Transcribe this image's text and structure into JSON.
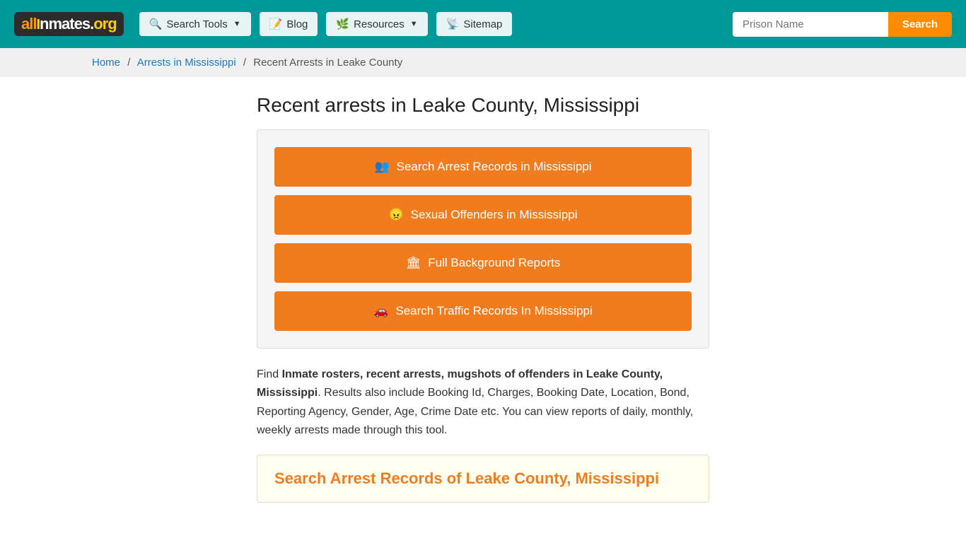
{
  "header": {
    "logo": "allinmates.org",
    "nav": [
      {
        "id": "search-tools",
        "label": "Search Tools",
        "has_arrow": true
      },
      {
        "id": "blog",
        "label": "Blog",
        "has_arrow": false
      },
      {
        "id": "resources",
        "label": "Resources",
        "has_arrow": true
      },
      {
        "id": "sitemap",
        "label": "Sitemap",
        "has_arrow": false
      }
    ],
    "search_placeholder": "Prison Name",
    "search_btn_label": "Search"
  },
  "breadcrumb": {
    "home": "Home",
    "sep1": "/",
    "arrests": "Arrests in Mississippi",
    "sep2": "/",
    "current": "Recent Arrests in Leake County"
  },
  "page": {
    "title": "Recent arrests in Leake County, Mississippi",
    "buttons": [
      {
        "id": "arrest-records",
        "icon": "👥",
        "label": "Search Arrest Records in Mississippi"
      },
      {
        "id": "sex-offenders",
        "icon": "😠",
        "label": "Sexual Offenders in Mississippi"
      },
      {
        "id": "background-reports",
        "icon": "🏛",
        "label": "Full Background Reports"
      },
      {
        "id": "traffic-records",
        "icon": "🚗",
        "label": "Search Traffic Records In Mississippi"
      }
    ],
    "description_plain": "Find ",
    "description_bold": "Inmate rosters, recent arrests, mugshots of offenders in Leake County, Mississippi",
    "description_rest": ". Results also include Booking Id, Charges, Booking Date, Location, Bond, Reporting Agency, Gender, Age, Crime Date etc. You can view reports of daily, monthly, weekly arrests made through this tool.",
    "search_records_title": "Search Arrest Records of Leake County, Mississippi"
  }
}
